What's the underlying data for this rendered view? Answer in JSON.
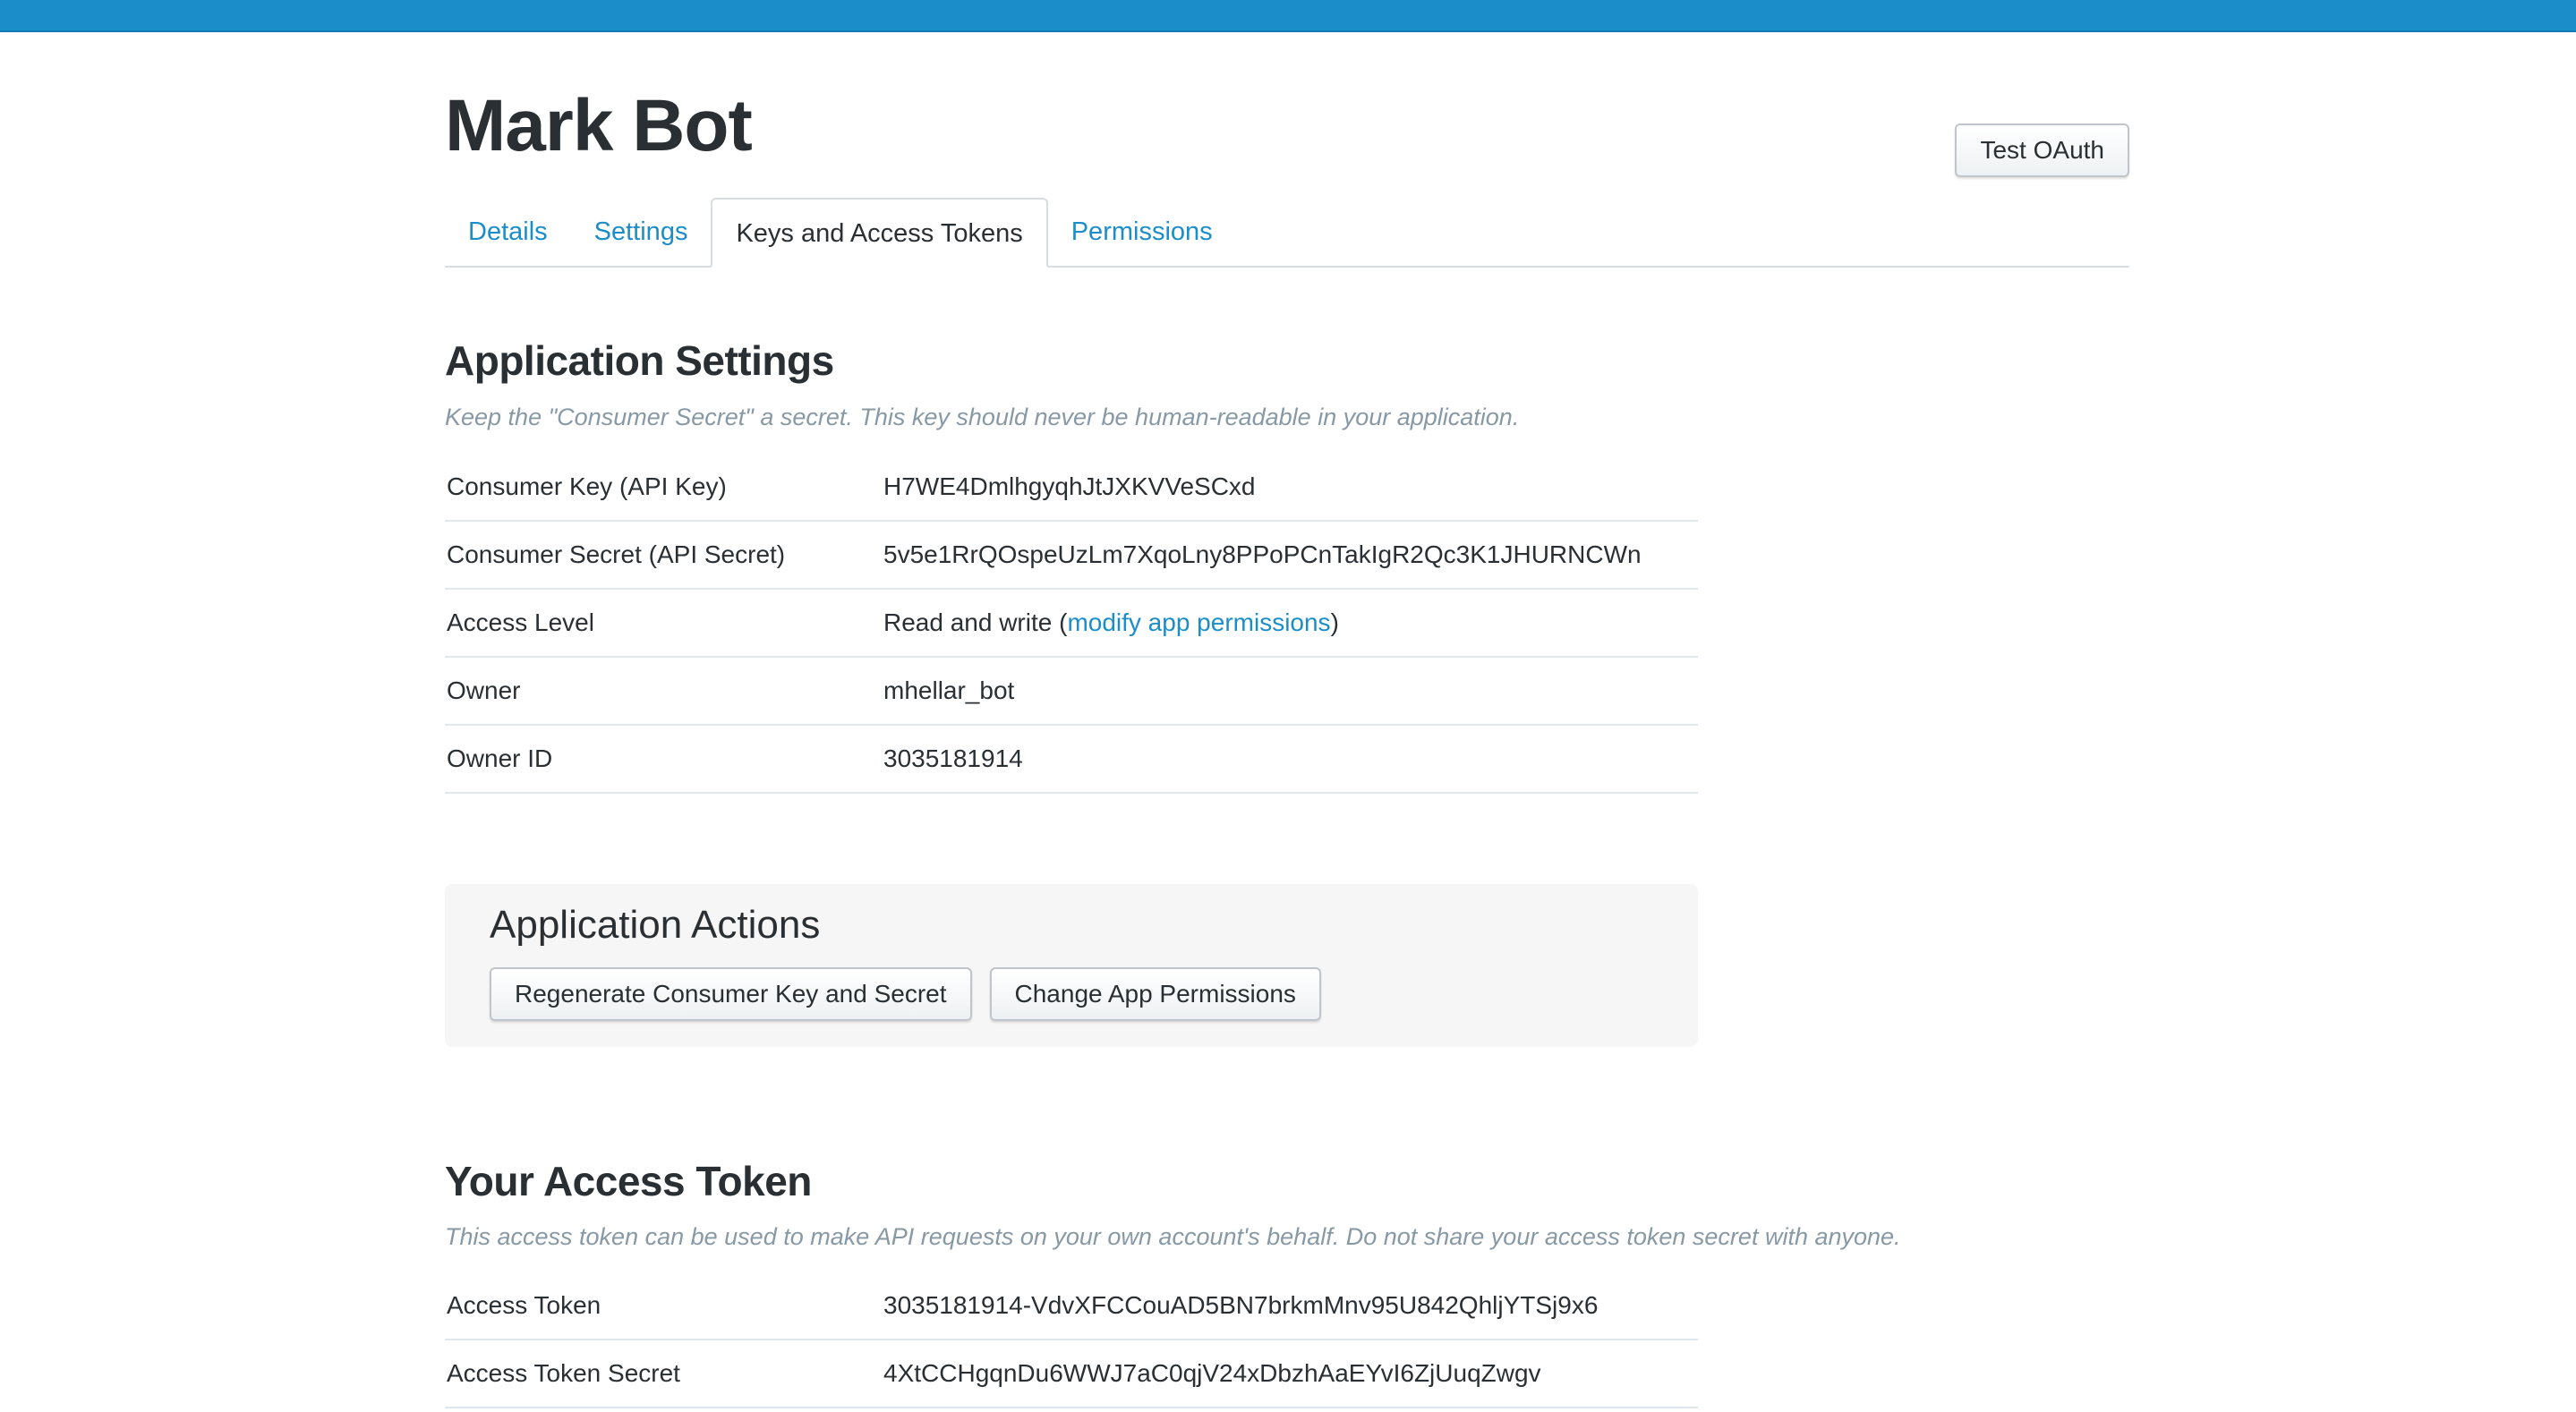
{
  "app": {
    "title": "Mark Bot",
    "test_oauth_label": "Test OAuth"
  },
  "tabs": [
    {
      "label": "Details",
      "active": false
    },
    {
      "label": "Settings",
      "active": false
    },
    {
      "label": "Keys and Access Tokens",
      "active": true
    },
    {
      "label": "Permissions",
      "active": false
    }
  ],
  "application_settings": {
    "title": "Application Settings",
    "description": "Keep the \"Consumer Secret\" a secret. This key should never be human-readable in your application.",
    "rows": [
      {
        "key": "Consumer Key (API Key)",
        "value": "H7WE4DmlhgyqhJtJXKVVeSCxd"
      },
      {
        "key": "Consumer Secret (API Secret)",
        "value": "5v5e1RrQOspeUzLm7XqoLny8PPoPCnTakIgR2Qc3K1JHURNCWn"
      },
      {
        "key": "Access Level",
        "value_prefix": "Read and write (",
        "value_link": "modify app permissions",
        "value_suffix": ")"
      },
      {
        "key": "Owner",
        "value": "mhellar_bot"
      },
      {
        "key": "Owner ID",
        "value": "3035181914"
      }
    ]
  },
  "application_actions": {
    "title": "Application Actions",
    "regenerate_label": "Regenerate Consumer Key and Secret",
    "change_permissions_label": "Change App Permissions"
  },
  "access_token": {
    "title": "Your Access Token",
    "description": "This access token can be used to make API requests on your own account's behalf. Do not share your access token secret with anyone.",
    "rows": [
      {
        "key": "Access Token",
        "value": "3035181914-VdvXFCCouAD5BN7brkmMnv95U842QhljYTSj9x6"
      },
      {
        "key": "Access Token Secret",
        "value": "4XtCCHgqnDu6WWJ7aC0qjV24xDbzhAaEYvI6ZjUuqZwgv"
      }
    ]
  },
  "colors": {
    "accent": "#1b8ec9",
    "text": "#292f33",
    "muted": "#8899a6"
  }
}
